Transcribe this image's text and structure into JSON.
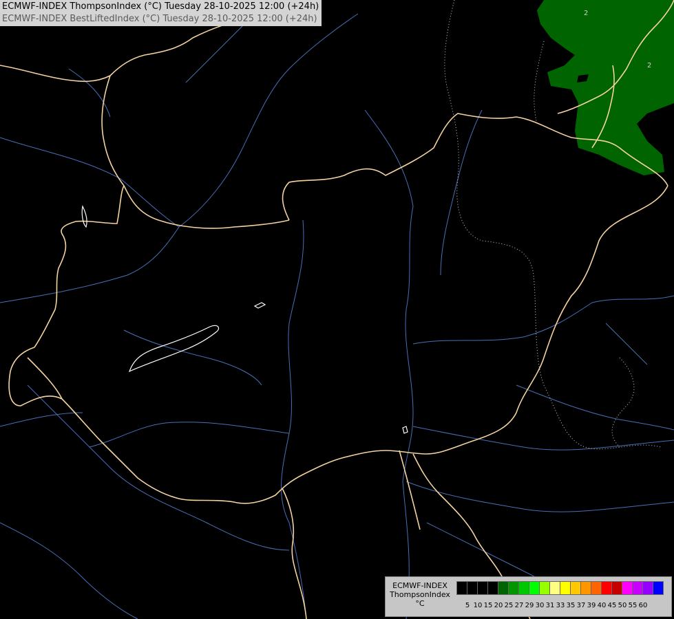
{
  "title": {
    "line1": "ECMWF-INDEX ThompsonIndex (°C) Tuesday 28-10-2025 12:00 (+24h)",
    "line2": "ECMWF-INDEX BestLiftedIndex (°C) Tuesday 28-10-2025 12:00 (+24h)"
  },
  "map": {
    "background_color": "#000000",
    "border_color": "#f5d3a0",
    "river_color": "#4a6fb8",
    "lake_color": "#ffffff",
    "contour_color": "#cfcfcf",
    "contour_labels": [
      "2",
      "2"
    ],
    "shaded_region_color": "#006400"
  },
  "legend": {
    "label_lines": [
      "ECMWF-INDEX",
      "ThompsonIndex",
      "°C"
    ],
    "ticks": [
      "5",
      "10",
      "15",
      "20",
      "25",
      "27",
      "29",
      "30",
      "31",
      "33",
      "35",
      "37",
      "39",
      "40",
      "45",
      "50",
      "55",
      "60"
    ],
    "colors": [
      "#000000",
      "#000000",
      "#000000",
      "#000000",
      "#006400",
      "#009600",
      "#00c800",
      "#00ff00",
      "#96ff00",
      "#ffff80",
      "#ffff00",
      "#ffc800",
      "#ff9600",
      "#ff6400",
      "#ff0000",
      "#c80000",
      "#ff00ff",
      "#c800ff",
      "#9600ff",
      "#0000ff"
    ]
  }
}
